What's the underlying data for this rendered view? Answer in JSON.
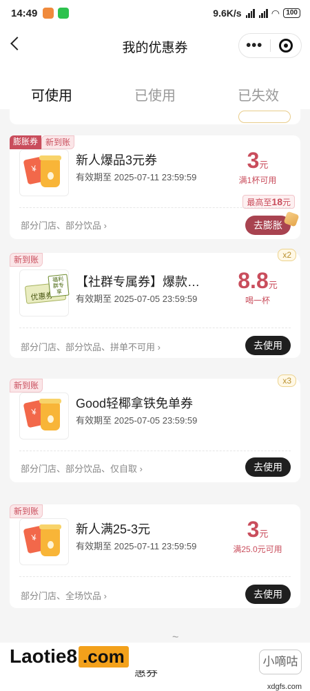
{
  "status_bar": {
    "time": "14:49",
    "network_speed": "9.6K/s",
    "battery": "100"
  },
  "nav": {
    "title": "我的优惠券",
    "more": "•••"
  },
  "tabs": [
    {
      "label": "可使用",
      "active": true
    },
    {
      "label": "已使用",
      "active": false
    },
    {
      "label": "已失效",
      "active": false
    }
  ],
  "coupons": [
    {
      "tags": [
        "膨胀券",
        "新到账"
      ],
      "title": "新人爆品3元券",
      "expiry": "有效期至 2025-07-11 23:59:59",
      "value": "3",
      "unit": "元",
      "condition": "满1杯可用",
      "max_prefix": "最高至",
      "max_value": "18",
      "max_unit": "元",
      "scope": "部分门店、部分饮品 ›",
      "button": "去膨胀"
    },
    {
      "tags": [
        "新到账"
      ],
      "multiplier": "x2",
      "title": "【社群专属券】爆款…",
      "thumb_label": "福利群专享",
      "thumb_text": "优惠券",
      "expiry": "有效期至 2025-07-05 23:59:59",
      "value": "8.8",
      "unit": "元",
      "condition": "喝一杯",
      "scope": "部分门店、部分饮品、拼单不可用 ›",
      "button": "去使用"
    },
    {
      "tags": [
        "新到账"
      ],
      "multiplier": "x3",
      "title": "Good轻椰拿铁免单券",
      "expiry": "有效期至 2025-07-05 23:59:59",
      "scope": "部分门店、部分饮品、仅自取 ›",
      "button": "去使用"
    },
    {
      "tags": [
        "新到账"
      ],
      "title": "新人满25-3元",
      "expiry": "有效期至 2025-07-11 23:59:59",
      "value": "3",
      "unit": "元",
      "condition": "满25.0元可用",
      "scope": "部分门店、全场饮品 ›",
      "button": "去使用"
    }
  ],
  "footer": {
    "tilde": "~",
    "button": "惠券"
  },
  "watermarks": {
    "brand_left": "Laotie8",
    "brand_right": ".com",
    "corner": "小嘀咕",
    "corner_url": "xdgfs.com"
  }
}
